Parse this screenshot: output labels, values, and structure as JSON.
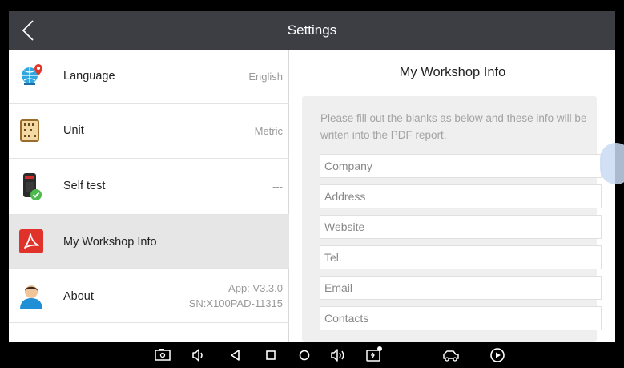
{
  "header": {
    "title": "Settings",
    "back_icon": "chevron-left-icon"
  },
  "settings_list": {
    "items": [
      {
        "label": "Language",
        "value": "English",
        "icon": "globe-pin-icon"
      },
      {
        "label": "Unit",
        "value": "Metric",
        "icon": "abacus-icon"
      },
      {
        "label": "Self test",
        "value": "---",
        "icon": "device-check-icon"
      },
      {
        "label": "My Workshop Info",
        "value": "",
        "icon": "pdf-icon",
        "selected": true
      },
      {
        "label": "About",
        "value": "App: V3.3.0",
        "value2": "SN:X100PAD-11315",
        "icon": "person-icon"
      }
    ]
  },
  "workshop": {
    "title": "My Workshop Info",
    "note": "Please fill out the blanks as below and these info will be writen into the PDF report.",
    "fields": [
      {
        "placeholder": "Company"
      },
      {
        "placeholder": "Address"
      },
      {
        "placeholder": "Website"
      },
      {
        "placeholder": "Tel."
      },
      {
        "placeholder": "Email"
      },
      {
        "placeholder": "Contacts"
      }
    ]
  },
  "navbar": {
    "icons": [
      "screenshot-icon",
      "volume-down-icon",
      "back-triangle-icon",
      "recent-apps-icon",
      "home-circle-icon",
      "volume-up-icon",
      "vci-icon",
      "car-icon",
      "play-circle-icon"
    ]
  },
  "colors": {
    "header_bg": "#3c3e44",
    "selected_row": "#e6e6e6",
    "form_bg": "#efefef"
  }
}
